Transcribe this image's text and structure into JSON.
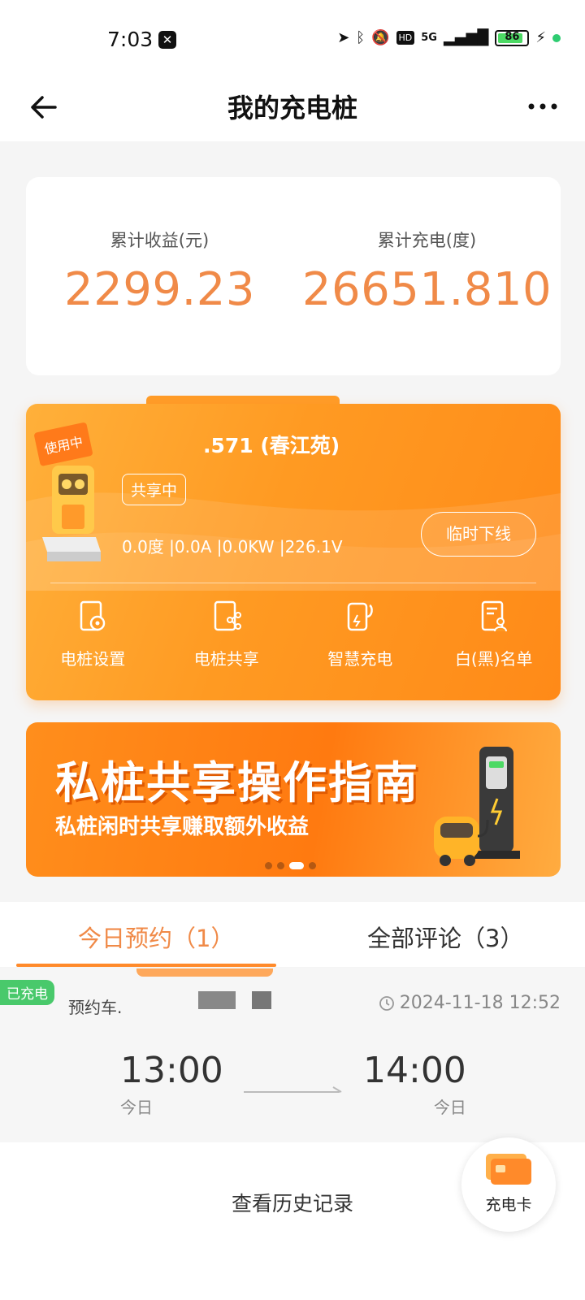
{
  "status_bar": {
    "time": "7:03",
    "network": "5G",
    "hd": "HD",
    "battery": "86"
  },
  "header": {
    "title": "我的充电桩"
  },
  "stats": {
    "earnings_label": "累计收益(元)",
    "earnings_value": "2299.23",
    "energy_label": "累计充电(度)",
    "energy_value": "26651.810"
  },
  "pile": {
    "illustration_text": "使用中",
    "name": ".571 (春江苑)",
    "share_badge": "共享中",
    "readings": "0.0度 |0.0A |0.0KW |226.1V",
    "offline_button": "临时下线",
    "actions": [
      {
        "label": "电桩设置",
        "icon": "settings-doc-icon"
      },
      {
        "label": "电桩共享",
        "icon": "share-doc-icon"
      },
      {
        "label": "智慧充电",
        "icon": "smart-charge-icon"
      },
      {
        "label": "白(黑)名单",
        "icon": "list-user-icon"
      }
    ]
  },
  "banner": {
    "title": "私桩共享操作指南",
    "subtitle": "私桩闲时共享赚取额外收益",
    "dots": 4,
    "active_dot": 3
  },
  "tabs": {
    "today": "今日预约（1）",
    "reviews": "全部评论（3）"
  },
  "booking": {
    "status_badge": "已充电",
    "plate_label": "预约车.",
    "created_at": "2024-11-18 12:52",
    "start_time": "13:00",
    "start_day": "今日",
    "end_time": "14:00",
    "end_day": "今日"
  },
  "footer": {
    "history_link": "查看历史记录",
    "fab_label": "充电卡"
  },
  "colors": {
    "accent": "#f08a48",
    "card_orange": "#ff9a22",
    "success": "#49c96b"
  }
}
